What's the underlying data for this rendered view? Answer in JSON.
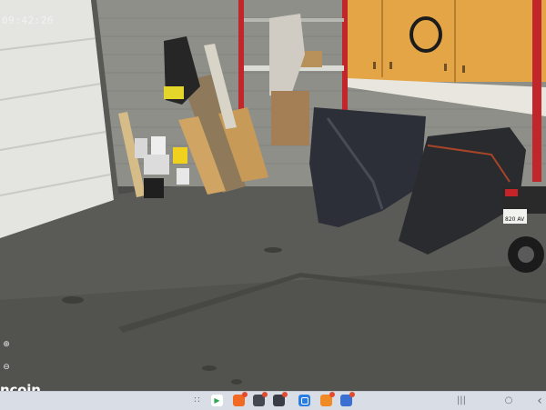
{
  "camera": {
    "timestamp": "09:42:26",
    "watermark": "ncoin"
  },
  "side_tools": [
    {
      "name": "zoom-in-icon",
      "glyph": "⊕"
    },
    {
      "name": "zoom-out-icon",
      "glyph": "⊖"
    }
  ],
  "taskbar": {
    "apps": [
      {
        "name": "apps-grid-icon",
        "glyph": "∷",
        "color": "#8a8f99",
        "badge": false
      },
      {
        "name": "play-store-icon",
        "glyph": "▶",
        "color": "#2fa84f",
        "badge": false
      },
      {
        "name": "app-icon-orange",
        "glyph": "●",
        "color": "#f06a24",
        "badge": true
      },
      {
        "name": "app-icon-dark",
        "glyph": "●",
        "color": "#444851",
        "badge": true
      },
      {
        "name": "app-icon-camera",
        "glyph": "●",
        "color": "#3a3d44",
        "badge": true
      },
      {
        "name": "app-icon-blue",
        "glyph": "■",
        "color": "#2a7de1",
        "badge": false
      },
      {
        "name": "app-icon-orange-2",
        "glyph": "●",
        "color": "#f08a24",
        "badge": true
      },
      {
        "name": "app-icon-multi",
        "glyph": "●",
        "color": "#3b6fd1",
        "badge": true
      }
    ],
    "nav": [
      {
        "name": "recent-apps-icon",
        "glyph": "|||"
      },
      {
        "name": "home-icon",
        "glyph": "○"
      },
      {
        "name": "back-icon",
        "glyph": "‹"
      }
    ]
  },
  "scene": {
    "plate_text": "820 AV"
  }
}
